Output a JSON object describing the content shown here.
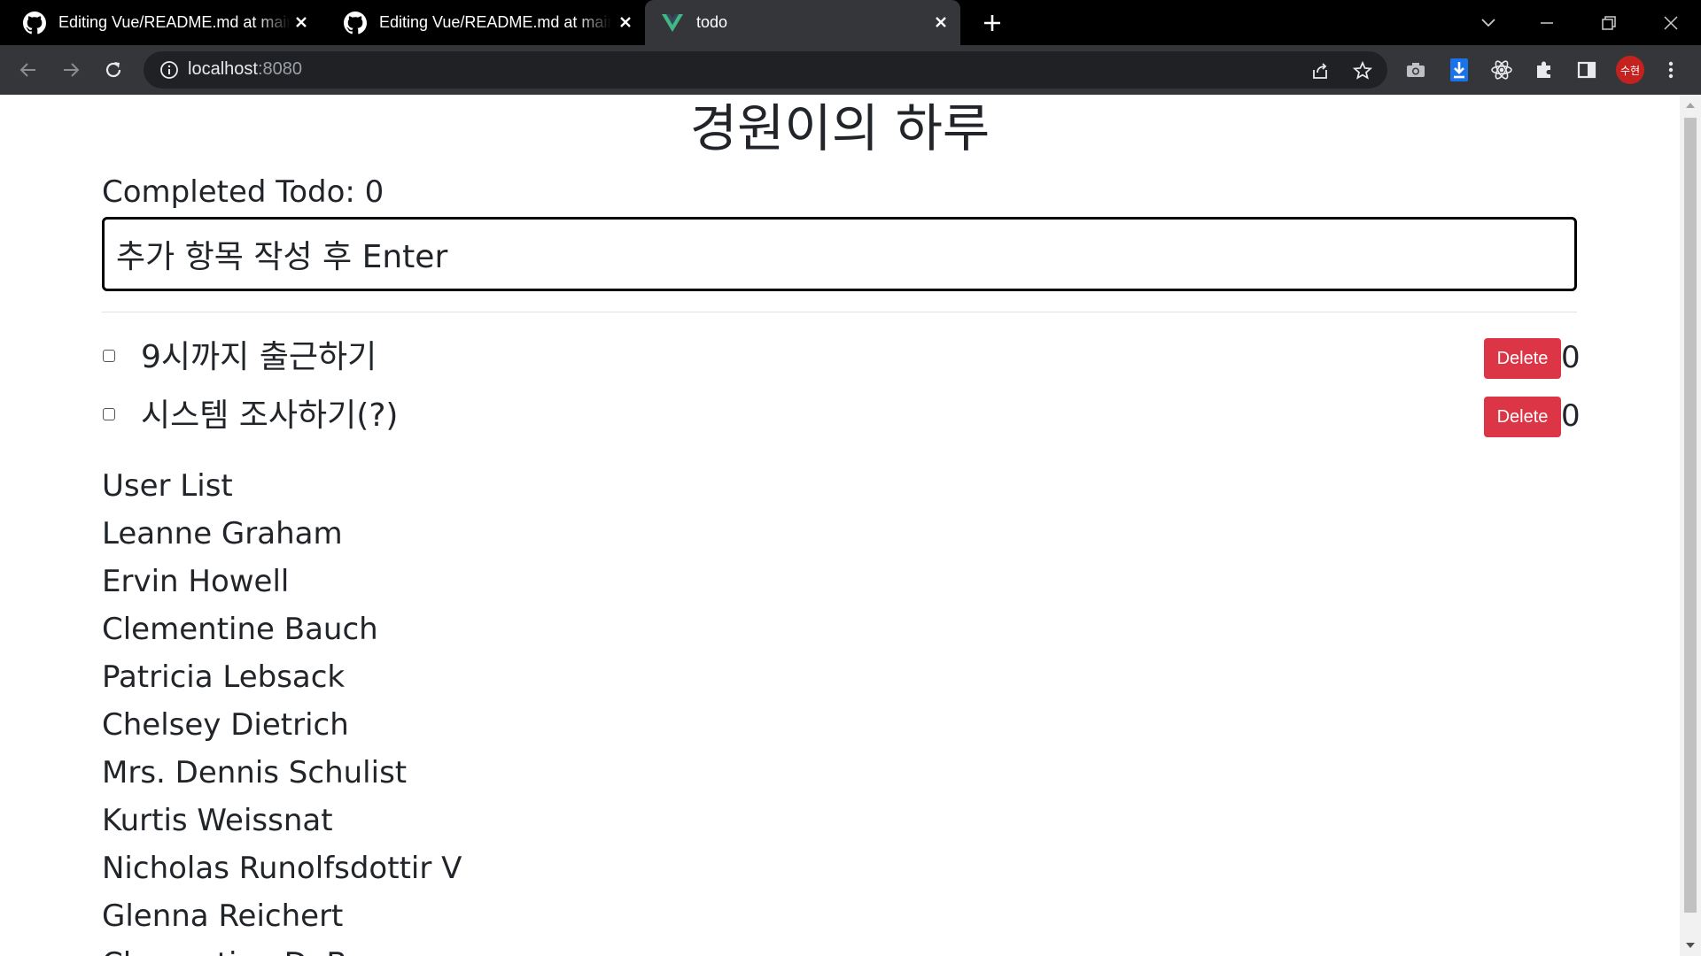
{
  "browser": {
    "tabs": [
      {
        "title": "Editing Vue/README.md at main",
        "icon": "github-icon",
        "active": false
      },
      {
        "title": "Editing Vue/README.md at main",
        "icon": "github-icon",
        "active": false
      },
      {
        "title": "todo",
        "icon": "vue-icon",
        "active": true
      }
    ],
    "url_host": "localhost",
    "url_port": ":8080",
    "profile_initials": "수현",
    "accent": "#35363a"
  },
  "app": {
    "title": "경원이의 하루",
    "completed_label": "Completed Todo: 0",
    "input_value": "추가 항목 작성 후 Enter",
    "todos": [
      {
        "text": "9시까지 출근하기",
        "delete_label": "Delete",
        "count": "0",
        "checked": false
      },
      {
        "text": "시스템 조사하기(?)",
        "delete_label": "Delete",
        "count": "0",
        "checked": false
      }
    ],
    "user_list_title": "User List",
    "users": [
      "Leanne Graham",
      "Ervin Howell",
      "Clementine Bauch",
      "Patricia Lebsack",
      "Chelsey Dietrich",
      "Mrs. Dennis Schulist",
      "Kurtis Weissnat",
      "Nicholas Runolfsdottir V",
      "Glenna Reichert",
      "Clementina DuBuque"
    ],
    "delete_color": "#dc3545"
  }
}
